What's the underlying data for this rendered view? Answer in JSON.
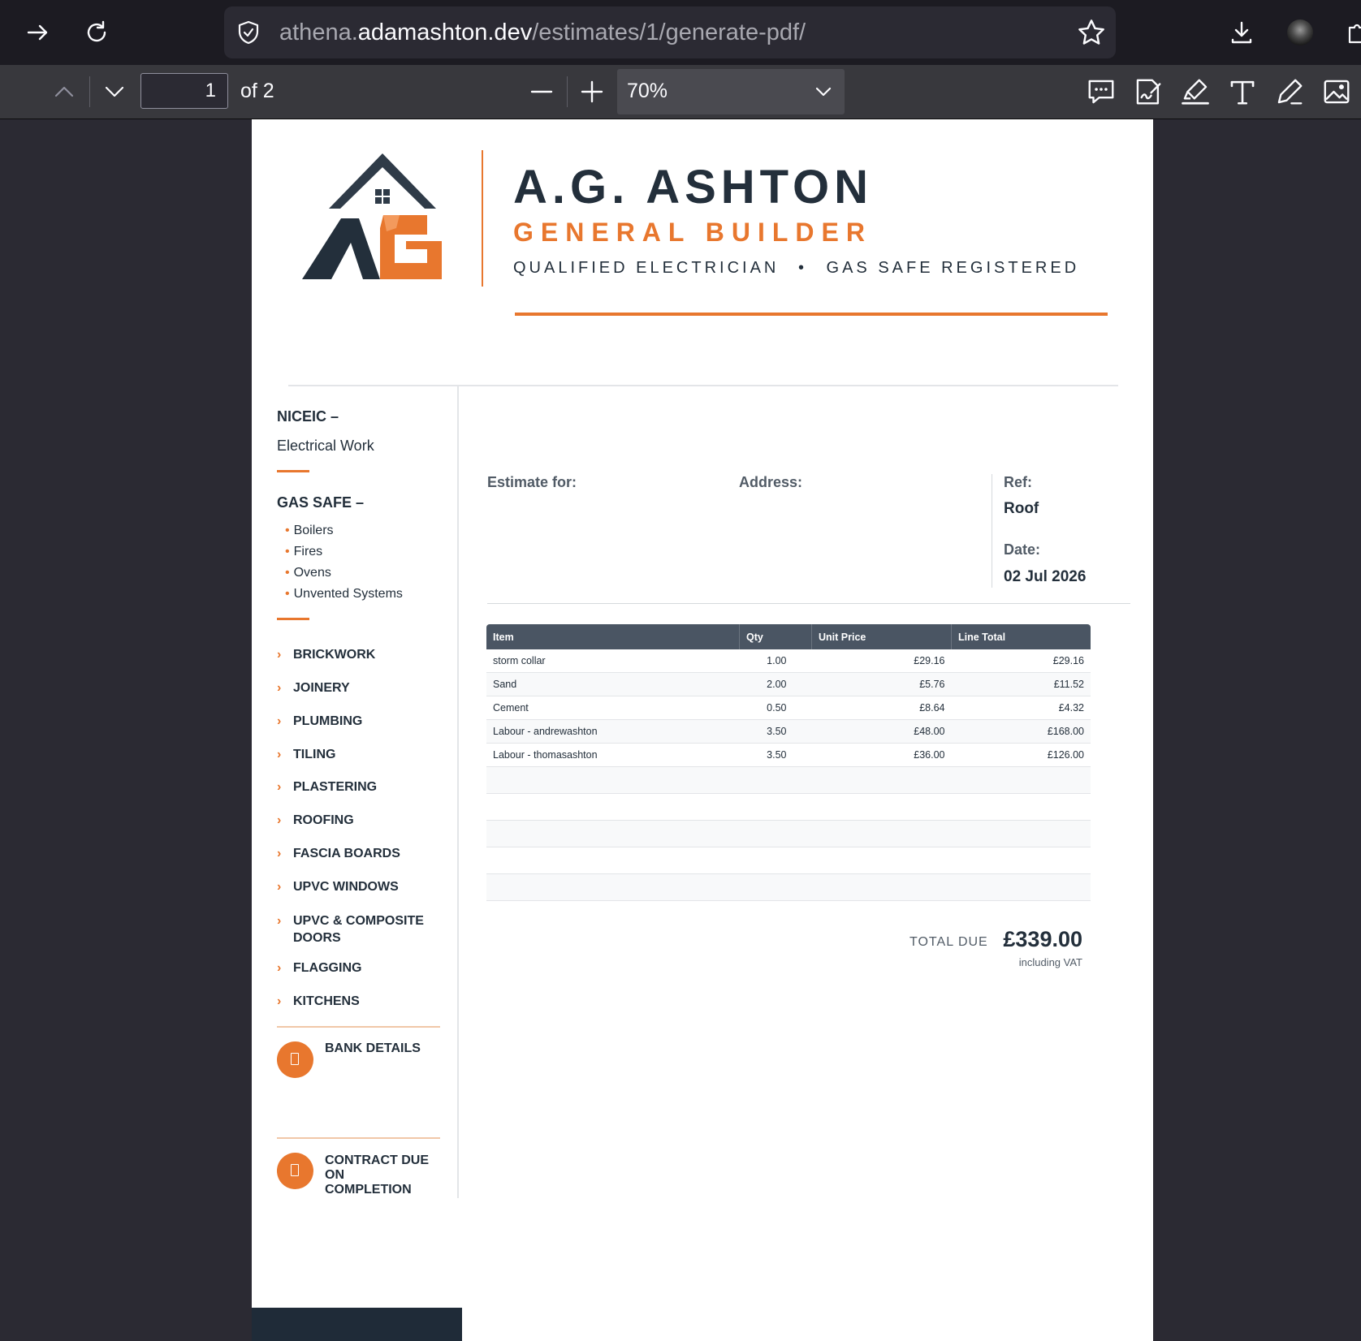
{
  "browser": {
    "url_prefix": "athena.",
    "url_domain": "adamashton.dev",
    "url_path": "/estimates/1/generate-pdf/"
  },
  "pdf_toolbar": {
    "page_number": "1",
    "page_count_label": "of 2",
    "zoom": "70%"
  },
  "document": {
    "brand": {
      "title": "A.G. ASHTON",
      "subtitle": "GENERAL BUILDER",
      "tagline_1": "QUALIFIED ELECTRICIAN",
      "tagline_sep": "•",
      "tagline_2": "GAS SAFE REGISTERED"
    },
    "sidebar": {
      "niceic_heading": "NICEIC –",
      "niceic_text": "Electrical Work",
      "gas_heading": "GAS SAFE –",
      "gas_items": [
        "Boilers",
        "Fires",
        "Ovens",
        "Unvented Systems"
      ],
      "services": [
        "BRICKWORK",
        "JOINERY",
        "PLUMBING",
        "TILING",
        "PLASTERING",
        "ROOFING",
        "FASCIA BOARDS",
        "UPVC WINDOWS",
        "UPVC & COMPOSITE",
        "DOORS",
        "FLAGGING",
        "KITCHENS"
      ],
      "bank_details": "BANK DETAILS",
      "contract_line1": "CONTRACT DUE",
      "contract_line2": "ON",
      "contract_line3": "COMPLETION"
    },
    "info": {
      "estimate_for_label": "Estimate for:",
      "address_label": "Address:",
      "ref_label": "Ref:",
      "ref_value": "Roof",
      "date_label": "Date:",
      "date_value": "02 Jul 2026"
    },
    "table": {
      "headers": [
        "Item",
        "Qty",
        "Unit Price",
        "Line Total"
      ],
      "rows": [
        {
          "item": "storm collar",
          "qty": "1.00",
          "unit": "£29.16",
          "total": "£29.16"
        },
        {
          "item": "Sand",
          "qty": "2.00",
          "unit": "£5.76",
          "total": "£11.52"
        },
        {
          "item": "Cement",
          "qty": "0.50",
          "unit": "£8.64",
          "total": "£4.32"
        },
        {
          "item": "Labour - andrewashton",
          "qty": "3.50",
          "unit": "£48.00",
          "total": "£168.00"
        },
        {
          "item": "Labour - thomasashton",
          "qty": "3.50",
          "unit": "£36.00",
          "total": "£126.00"
        }
      ]
    },
    "totals": {
      "label": "TOTAL DUE",
      "amount": "£339.00",
      "note": "including VAT"
    }
  },
  "colors": {
    "accent": "#e8772e",
    "navy": "#232f3b",
    "table_header": "#4a5563",
    "chrome_bg": "#1c1b22"
  }
}
